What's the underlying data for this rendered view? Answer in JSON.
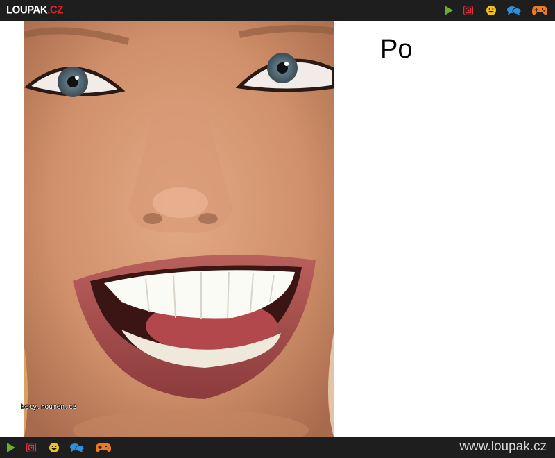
{
  "header": {
    "logo_main": "LOUPAK",
    "logo_suffix": ".CZ",
    "icons": [
      "play-icon",
      "instagram-icon",
      "smiley-icon",
      "chat-icon",
      "gamepad-icon"
    ]
  },
  "content": {
    "caption": "Po",
    "watermark": "kecy.roumen.cz"
  },
  "footer": {
    "url": "www.loupak.cz",
    "icons": [
      "play-icon",
      "instagram-icon",
      "smiley-icon",
      "chat-icon",
      "gamepad-icon"
    ]
  },
  "colors": {
    "bar_bg": "#1e1e1e",
    "logo_red": "#e52226",
    "play": "#6ab023",
    "instagram": "#e0313c",
    "smiley": "#f2c21b",
    "chat": "#2f8fd8",
    "gamepad": "#f07b1e"
  }
}
